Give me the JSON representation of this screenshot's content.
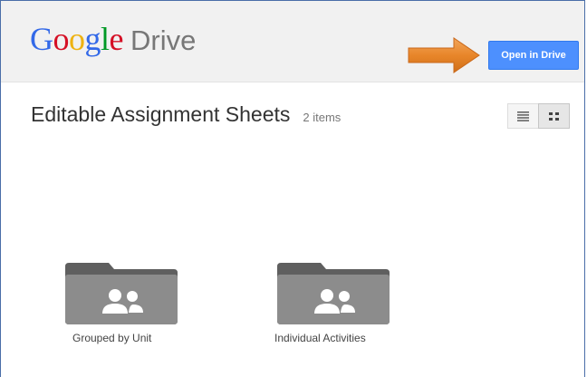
{
  "header": {
    "logo": {
      "letters": [
        {
          "char": "G",
          "color": "#3369e8"
        },
        {
          "char": "o",
          "color": "#d50f25"
        },
        {
          "char": "o",
          "color": "#eeb211"
        },
        {
          "char": "g",
          "color": "#3369e8"
        },
        {
          "char": "l",
          "color": "#009925"
        },
        {
          "char": "e",
          "color": "#d50f25"
        }
      ],
      "product": "Drive"
    },
    "open_button_label": "Open in Drive",
    "arrow_color": "#e8862a",
    "button_color": "#4d90fe"
  },
  "main": {
    "title": "Editable Assignment Sheets",
    "item_count": "2 items",
    "view_toggle": {
      "list_icon": "list-view-icon",
      "grid_icon": "grid-view-icon",
      "active": "grid"
    },
    "folders": [
      {
        "name": "Grouped by Unit",
        "icon": "shared-folder-icon"
      },
      {
        "name": "Individual Activities",
        "icon": "shared-folder-icon"
      }
    ],
    "folder_color": "#8c8c8c",
    "folder_tab_color": "#5f5f5f"
  }
}
